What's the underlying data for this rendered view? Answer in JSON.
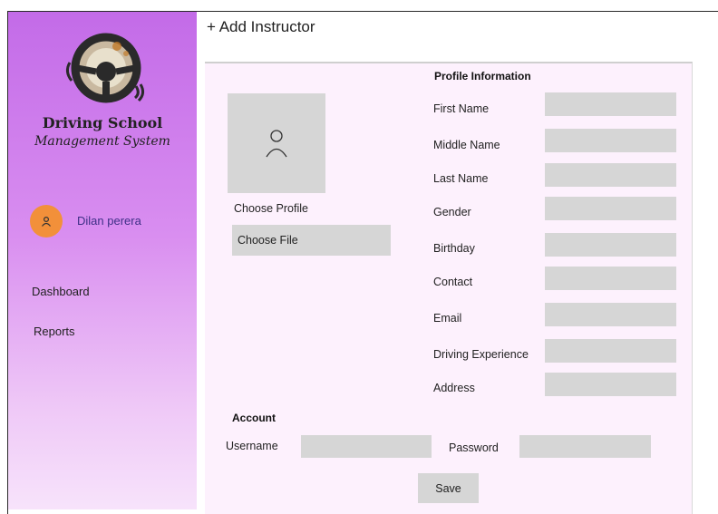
{
  "sidebar": {
    "brand_line1": "Driving School",
    "brand_line2": "Management System",
    "user_name": "Dilan perera",
    "nav": [
      "Dashboard",
      "Reports"
    ]
  },
  "page": {
    "title": "+ Add Instructor"
  },
  "profile": {
    "section_title": "Profile Information",
    "choose_profile_label": "Choose Profile",
    "choose_file_label": "Choose File",
    "fields": [
      {
        "label": "First Name",
        "value": ""
      },
      {
        "label": "Middle Name",
        "value": ""
      },
      {
        "label": "Last Name",
        "value": ""
      },
      {
        "label": "Gender",
        "value": ""
      },
      {
        "label": "Birthday",
        "value": ""
      },
      {
        "label": "Contact",
        "value": ""
      },
      {
        "label": "Email",
        "value": ""
      },
      {
        "label": "Driving Experience",
        "value": ""
      },
      {
        "label": "Address",
        "value": ""
      }
    ]
  },
  "account": {
    "section_title": "Account",
    "username_label": "Username",
    "username_value": "",
    "password_label": "Password",
    "password_value": ""
  },
  "actions": {
    "save_label": "Save"
  },
  "colors": {
    "sidebar_top": "#c36be8",
    "sidebar_bottom": "#f7e3fb",
    "avatar": "#f2903a",
    "username_text": "#3d2f86",
    "card_bg": "#fdf1fd",
    "field_bg": "#d6d6d6"
  },
  "icons": {
    "logo": "steering-wheel-logo",
    "avatar": "user-icon",
    "photo": "person-icon"
  }
}
